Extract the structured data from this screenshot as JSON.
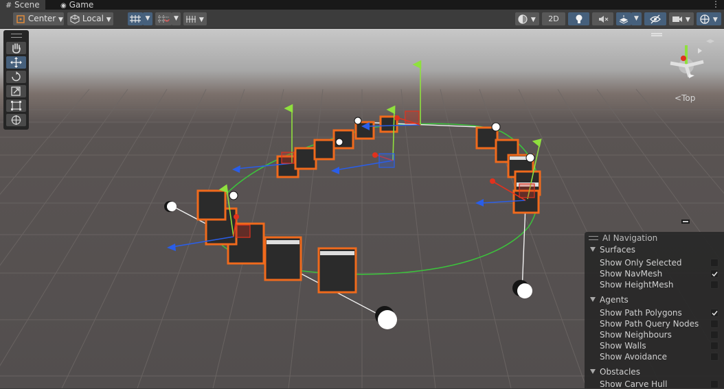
{
  "tabs": [
    {
      "label": "Scene",
      "icon": "grid-icon"
    },
    {
      "label": "Game",
      "icon": "gamepad-icon"
    }
  ],
  "toolbar": {
    "pivot_mode": "Center",
    "pivot_rotation": "Local",
    "mode_2d": "2D"
  },
  "tools": [
    "hand-tool",
    "move-tool",
    "rotate-tool",
    "scale-tool",
    "rect-tool",
    "transform-tool"
  ],
  "gizmo": {
    "label": "Top"
  },
  "ai_navigation": {
    "title": "AI Navigation",
    "sections": [
      {
        "name": "Surfaces",
        "items": [
          {
            "label": "Show Only Selected",
            "checked": false
          },
          {
            "label": "Show NavMesh",
            "checked": true
          },
          {
            "label": "Show HeightMesh",
            "checked": false
          }
        ]
      },
      {
        "name": "Agents",
        "items": [
          {
            "label": "Show Path Polygons",
            "checked": true
          },
          {
            "label": "Show Path Query Nodes",
            "checked": false
          },
          {
            "label": "Show Neighbours",
            "checked": false
          },
          {
            "label": "Show Walls",
            "checked": false
          },
          {
            "label": "Show Avoidance",
            "checked": false
          }
        ]
      },
      {
        "name": "Obstacles",
        "items": [
          {
            "label": "Show Carve Hull",
            "checked": false
          }
        ]
      }
    ]
  },
  "colors": {
    "accent": "#46607c",
    "selection_outline": "#f06a1c",
    "axis_x": "#e0321e",
    "axis_y": "#7ee03a",
    "axis_z": "#2a5ee8"
  }
}
